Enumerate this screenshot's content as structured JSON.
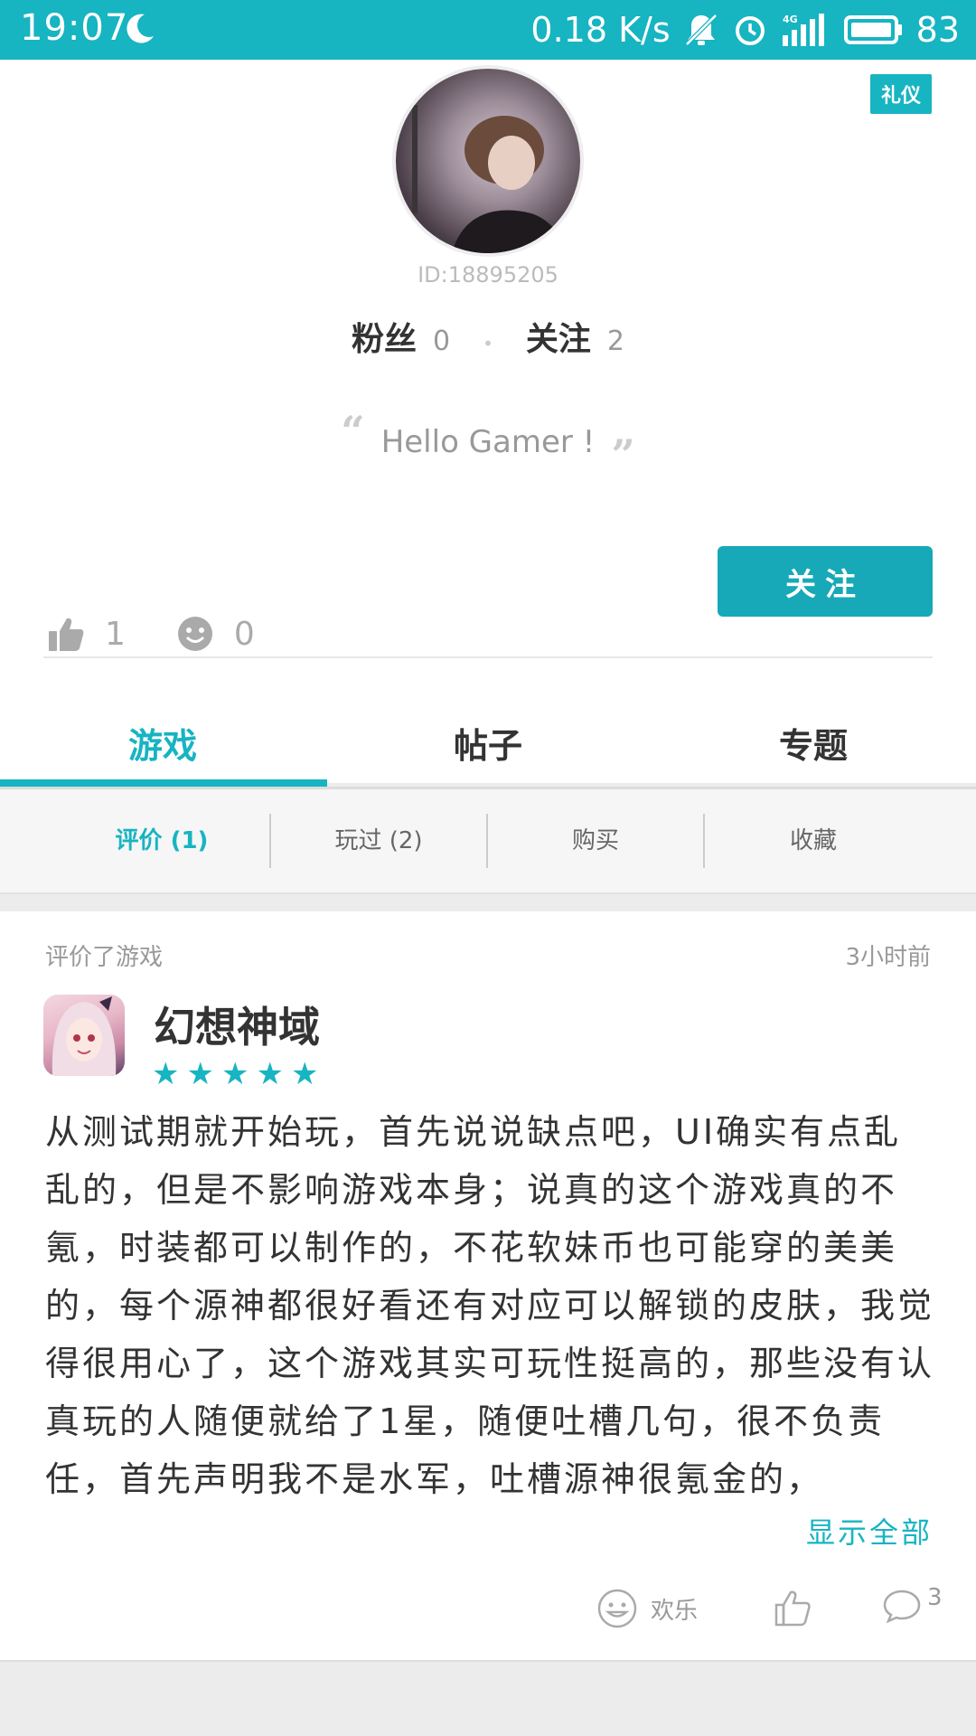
{
  "status_bar": {
    "time": "19:07",
    "speed": "0.18 K/s",
    "battery": "83"
  },
  "profile": {
    "badge": "礼仪",
    "user_id": "ID:18895205",
    "fans_label": "粉丝",
    "fans_count": "0",
    "following_label": "关注",
    "following_count": "2",
    "motto": "Hello Gamer !",
    "likes_count": "1",
    "happy_count": "0",
    "follow_button": "关注"
  },
  "tabs": [
    {
      "label": "游戏",
      "active": true
    },
    {
      "label": "帖子",
      "active": false
    },
    {
      "label": "专题",
      "active": false
    }
  ],
  "subtabs": [
    {
      "label": "评价 (1)",
      "active": true
    },
    {
      "label": "玩过 (2)",
      "active": false
    },
    {
      "label": "购买",
      "active": false
    },
    {
      "label": "收藏",
      "active": false
    }
  ],
  "review": {
    "meta": "评价了游戏",
    "time": "3小时前",
    "game_name": "幻想神域",
    "rating": 5,
    "text": "从测试期就开始玩，首先说说缺点吧，UI确实有点乱乱的，但是不影响游戏本身；说真的这个游戏真的不氪，时装都可以制作的，不花软妹币也可能穿的美美的，每个源神都很好看还有对应可以解锁的皮肤，我觉得很用心了，这个游戏其实可玩性挺高的，那些没有认真玩的人随便就给了1星，随便吐槽几句，很不负责任，首先声明我不是水军，吐槽源神很氪金的，",
    "show_all": "显示全部",
    "happy_label": "欢乐",
    "comment_count": "3"
  },
  "colors": {
    "accent": "#17b4c2",
    "button": "#17a9b7"
  }
}
